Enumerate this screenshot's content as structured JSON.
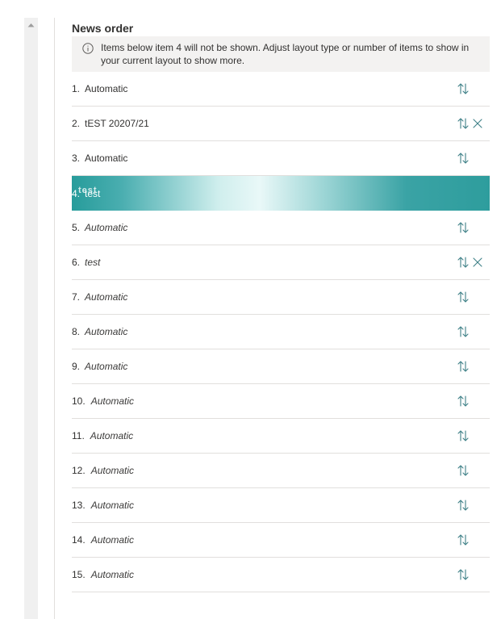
{
  "panel": {
    "title": "News order",
    "info_message": "Items below item 4 will not be shown. Adjust layout type or number of items to show in your current layout to show more."
  },
  "items": [
    {
      "number": "1.",
      "label": "Automatic",
      "italic": false,
      "removable": false
    },
    {
      "number": "2.",
      "label": "tEST 20207/21",
      "italic": false,
      "removable": true
    },
    {
      "number": "3.",
      "label": "Automatic",
      "italic": false,
      "removable": false
    },
    {
      "number": "4.",
      "label": "test",
      "italic": false,
      "removable": false,
      "dragging": true
    },
    {
      "number": "5.",
      "label": "Automatic",
      "italic": true,
      "removable": false
    },
    {
      "number": "6.",
      "label": "test",
      "italic": true,
      "removable": true
    },
    {
      "number": "7.",
      "label": "Automatic",
      "italic": true,
      "removable": false
    },
    {
      "number": "8.",
      "label": "Automatic",
      "italic": true,
      "removable": false
    },
    {
      "number": "9.",
      "label": "Automatic",
      "italic": true,
      "removable": false
    },
    {
      "number": "10.",
      "label": "Automatic",
      "italic": true,
      "removable": false
    },
    {
      "number": "11.",
      "label": "Automatic",
      "italic": true,
      "removable": false
    },
    {
      "number": "12.",
      "label": "Automatic",
      "italic": true,
      "removable": false
    },
    {
      "number": "13.",
      "label": "Automatic",
      "italic": true,
      "removable": false
    },
    {
      "number": "14.",
      "label": "Automatic",
      "italic": true,
      "removable": false
    },
    {
      "number": "15.",
      "label": "Automatic",
      "italic": true,
      "removable": false
    }
  ],
  "drag_ghost_text": "test",
  "icons": {
    "scroll_up": "chevron-up-icon",
    "info": "info-icon",
    "reorder": "reorder-arrows-icon",
    "remove": "close-icon"
  },
  "colors": {
    "accent": "#2e9d9d",
    "icon": "#3d7f86",
    "info_background": "#f3f2f1"
  }
}
